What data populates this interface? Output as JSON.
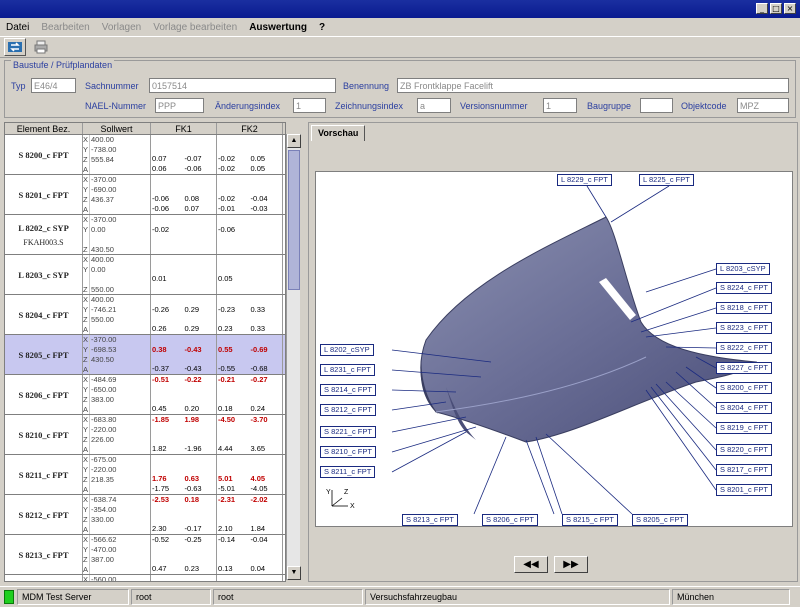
{
  "window": {
    "buttons": [
      "_",
      "□",
      "×"
    ]
  },
  "menu": [
    {
      "label": "Datei",
      "state": "normal"
    },
    {
      "label": "Bearbeiten",
      "state": "disabled"
    },
    {
      "label": "Vorlagen",
      "state": "disabled"
    },
    {
      "label": "Vorlage bearbeiten",
      "state": "disabled"
    },
    {
      "label": "Auswertung",
      "state": "bold"
    },
    {
      "label": "?",
      "state": "bold"
    }
  ],
  "toolbar": {
    "icons": [
      "refresh-icon",
      "print-icon"
    ]
  },
  "group": {
    "title": "Baustufe / Prüfplandaten"
  },
  "fields": {
    "typ": {
      "label": "Typ",
      "value": "E46/4"
    },
    "sachnummer": {
      "label": "Sachnummer",
      "value": "0157514"
    },
    "benennung": {
      "label": "Benennung",
      "value": "ZB Frontklappe Facelift"
    },
    "nael": {
      "label": "NAEL-Nummer",
      "value": "PPP"
    },
    "aenderungsindex": {
      "label": "Änderungsindex",
      "value": "1"
    },
    "zeichnungsindex": {
      "label": "Zeichnungsindex",
      "value": "a"
    },
    "versionsnummer": {
      "label": "Versionsnummer",
      "value": "1"
    },
    "baugruppe": {
      "label": "Baugruppe",
      "value": ""
    },
    "objektcode": {
      "label": "Objektcode",
      "value": "MPZ"
    }
  },
  "table": {
    "headers": [
      "Element Bez.",
      "Sollwert",
      "FK1",
      "FK2"
    ],
    "rows": [
      {
        "name": "S 8200_c FPT",
        "sub": "",
        "axes": [
          "X",
          "Y",
          "Z",
          "A"
        ],
        "soll": [
          "400.00",
          "-738.00",
          "555.84",
          ""
        ],
        "fk1": [
          [
            "",
            ""
          ],
          [
            "",
            ""
          ],
          [
            "0.07",
            "-0.07"
          ],
          [
            "0.06",
            "-0.06"
          ]
        ],
        "fk2": [
          [
            "",
            ""
          ],
          [
            "",
            ""
          ],
          [
            "-0.02",
            "0.05"
          ],
          [
            "-0.02",
            "0.05"
          ]
        ],
        "red": [],
        "selected": false
      },
      {
        "name": "S 8201_c FPT",
        "sub": "",
        "axes": [
          "X",
          "Y",
          "Z",
          "A"
        ],
        "soll": [
          "-370.00",
          "-690.00",
          "436.37",
          ""
        ],
        "fk1": [
          [
            "",
            ""
          ],
          [
            "",
            ""
          ],
          [
            "-0.06",
            "0.08"
          ],
          [
            "-0.06",
            "0.07"
          ]
        ],
        "fk2": [
          [
            "",
            ""
          ],
          [
            "",
            ""
          ],
          [
            "-0.02",
            "-0.04"
          ],
          [
            "-0.01",
            "-0.03"
          ]
        ],
        "red": [],
        "selected": false
      },
      {
        "name": "L 8202_c SYP",
        "sub": "FKAH003.S",
        "axes": [
          "X",
          "Y",
          "",
          "Z"
        ],
        "soll": [
          "-370.00",
          "0.00",
          "",
          "430.50"
        ],
        "fk1": [
          [
            "",
            ""
          ],
          [
            "-0.02",
            ""
          ],
          [
            "",
            ""
          ],
          [
            "",
            ""
          ]
        ],
        "fk2": [
          [
            "",
            ""
          ],
          [
            "-0.06",
            ""
          ],
          [
            "",
            ""
          ],
          [
            "",
            ""
          ]
        ],
        "red": [],
        "selected": false
      },
      {
        "name": "L 8203_c SYP",
        "sub": "",
        "axes": [
          "X",
          "Y",
          "",
          "Z"
        ],
        "soll": [
          "400.00",
          "0.00",
          "",
          "550.00"
        ],
        "fk1": [
          [
            "",
            ""
          ],
          [
            "",
            ""
          ],
          [
            "0.01",
            ""
          ],
          [
            "",
            ""
          ]
        ],
        "fk2": [
          [
            "",
            ""
          ],
          [
            "",
            ""
          ],
          [
            "0.05",
            ""
          ],
          [
            "",
            ""
          ]
        ],
        "red": [],
        "selected": false
      },
      {
        "name": "S 8204_c FPT",
        "sub": "",
        "axes": [
          "X",
          "Y",
          "Z",
          "A"
        ],
        "soll": [
          "400.00",
          "-746.21",
          "550.00",
          ""
        ],
        "fk1": [
          [
            "",
            ""
          ],
          [
            "-0.26",
            "0.29"
          ],
          [
            "",
            ""
          ],
          [
            "0.26",
            "0.29"
          ]
        ],
        "fk2": [
          [
            "",
            ""
          ],
          [
            "-0.23",
            "0.33"
          ],
          [
            "",
            ""
          ],
          [
            "0.23",
            "0.33"
          ]
        ],
        "red": [],
        "selected": false
      },
      {
        "name": "S 8205_c FPT",
        "sub": "",
        "axes": [
          "X",
          "Y",
          "Z",
          "A"
        ],
        "soll": [
          "-370.00",
          "-698.53",
          "430.50",
          ""
        ],
        "fk1": [
          [
            "",
            ""
          ],
          [
            "0.38",
            "-0.43"
          ],
          [
            "",
            ""
          ],
          [
            "-0.37",
            "-0.43"
          ]
        ],
        "fk2": [
          [
            "",
            ""
          ],
          [
            "0.55",
            "-0.69"
          ],
          [
            "",
            ""
          ],
          [
            "-0.55",
            "-0.68"
          ]
        ],
        "red": [
          1
        ],
        "selected": true
      },
      {
        "name": "S 8206_c FPT",
        "sub": "",
        "axes": [
          "X",
          "Y",
          "Z",
          "A"
        ],
        "soll": [
          "-484.69",
          "-650.00",
          "383.00",
          ""
        ],
        "fk1": [
          [
            "-0.51",
            "-0.22"
          ],
          [
            "",
            ""
          ],
          [
            "",
            ""
          ],
          [
            "0.45",
            "0.20"
          ]
        ],
        "fk2": [
          [
            "-0.21",
            "-0.27"
          ],
          [
            "",
            ""
          ],
          [
            "",
            ""
          ],
          [
            "0.18",
            "0.24"
          ]
        ],
        "red": [
          0
        ],
        "selected": false
      },
      {
        "name": "S 8210_c FPT",
        "sub": "",
        "axes": [
          "X",
          "Y",
          "Z",
          "A"
        ],
        "soll": [
          "-683.80",
          "-220.00",
          "226.00",
          ""
        ],
        "fk1": [
          [
            "-1.85",
            "1.98"
          ],
          [
            "",
            ""
          ],
          [
            "",
            ""
          ],
          [
            "1.82",
            "-1.96"
          ]
        ],
        "fk2": [
          [
            "-4.50",
            "-3.70"
          ],
          [
            "",
            ""
          ],
          [
            "",
            ""
          ],
          [
            "4.44",
            "3.65"
          ]
        ],
        "red": [
          0
        ],
        "selected": false
      },
      {
        "name": "S 8211_c FPT",
        "sub": "",
        "axes": [
          "X",
          "Y",
          "Z",
          "A"
        ],
        "soll": [
          "-675.00",
          "-220.00",
          "218.35",
          ""
        ],
        "fk1": [
          [
            "",
            ""
          ],
          [
            "",
            ""
          ],
          [
            "1.76",
            "0.63"
          ],
          [
            "-1.75",
            "-0.63"
          ]
        ],
        "fk2": [
          [
            "",
            ""
          ],
          [
            "",
            ""
          ],
          [
            "5.01",
            "4.05"
          ],
          [
            "-5.01",
            "-4.05"
          ]
        ],
        "red": [
          2
        ],
        "selected": false
      },
      {
        "name": "S 8212_c FPT",
        "sub": "",
        "axes": [
          "X",
          "Y",
          "Z",
          "A"
        ],
        "soll": [
          "-638.74",
          "-354.00",
          "330.00",
          ""
        ],
        "fk1": [
          [
            "-2.53",
            "0.18"
          ],
          [
            "",
            ""
          ],
          [
            "",
            ""
          ],
          [
            "2.30",
            "-0.17"
          ]
        ],
        "fk2": [
          [
            "-2.31",
            "-2.02"
          ],
          [
            "",
            ""
          ],
          [
            "",
            ""
          ],
          [
            "2.10",
            "1.84"
          ]
        ],
        "red": [
          0
        ],
        "selected": false
      },
      {
        "name": "S 8213_c FPT",
        "sub": "",
        "axes": [
          "X",
          "Y",
          "Z",
          "A"
        ],
        "soll": [
          "-566.62",
          "-470.00",
          "387.00",
          ""
        ],
        "fk1": [
          [
            "-0.52",
            "-0.25"
          ],
          [
            "",
            ""
          ],
          [
            "",
            ""
          ],
          [
            "0.47",
            "0.23"
          ]
        ],
        "fk2": [
          [
            "-0.14",
            "-0.04"
          ],
          [
            "",
            ""
          ],
          [
            "",
            ""
          ],
          [
            "0.13",
            "0.04"
          ]
        ],
        "red": [],
        "selected": false
      },
      {
        "name": "",
        "sub": "",
        "axes": [
          "X",
          "",
          "",
          ""
        ],
        "soll": [
          "-560.00",
          "",
          "",
          ""
        ],
        "fk1": [
          [
            "",
            ""
          ],
          [
            "",
            ""
          ],
          [
            "",
            ""
          ],
          [
            "",
            ""
          ]
        ],
        "fk2": [
          [
            "",
            ""
          ],
          [
            "",
            ""
          ],
          [
            "",
            ""
          ],
          [
            "",
            ""
          ]
        ],
        "red": [],
        "selected": false
      }
    ]
  },
  "preview": {
    "tab": "Vorschau",
    "callouts": [
      "L 8229_c FPT",
      "L 8225_c FPT",
      "L 8203_cSYP",
      "S 8224_c FPT",
      "S 8218_c FPT",
      "S 8223_c FPT",
      "S 8222_c FPT",
      "S 8227_c FPT",
      "S 8200_c FPT",
      "S 8204_c FPT",
      "S 8219_c FPT",
      "S 8220_c FPT",
      "S 8217_c FPT",
      "S 8201_c FPT",
      "L 8202_cSYP",
      "L 8231_c FPT",
      "S 8214_c FPT",
      "S 8212_c FPT",
      "S 8221_c FPT",
      "S 8210_c FPT",
      "S 8211_c FPT",
      "S 8213_c FPT",
      "S 8206_c FPT",
      "S 8215_c FPT",
      "S 8205_c FPT"
    ],
    "axes": [
      "Y",
      "X",
      "Z"
    ],
    "nav": [
      "◀◀",
      "▶▶"
    ]
  },
  "status": [
    "MDM Test Server",
    "root",
    "root",
    "Versuchsfahrzeugbau",
    "München"
  ]
}
